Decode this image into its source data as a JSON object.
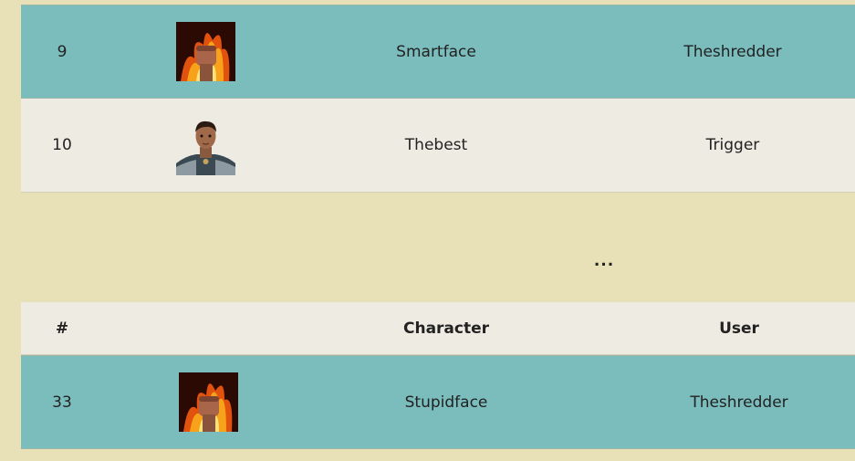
{
  "top_rows": [
    {
      "rank": "9",
      "avatar_icon": "flaming-fist-icon",
      "character": "Smartface",
      "user": "Theshredder"
    },
    {
      "rank": "10",
      "avatar_icon": "warrior-portrait-icon",
      "character": "Thebest",
      "user": "Trigger"
    }
  ],
  "ellipsis": "...",
  "bottom_table": {
    "headers": {
      "rank": "#",
      "character": "Character",
      "user": "User"
    },
    "rows": [
      {
        "rank": "33",
        "avatar_icon": "flaming-fist-icon",
        "character": "Stupidface",
        "user": "Theshredder"
      }
    ]
  },
  "colors": {
    "background": "#e8e1b8",
    "highlight_row": "#7bbcbd",
    "plain_row": "#eeebe3"
  }
}
